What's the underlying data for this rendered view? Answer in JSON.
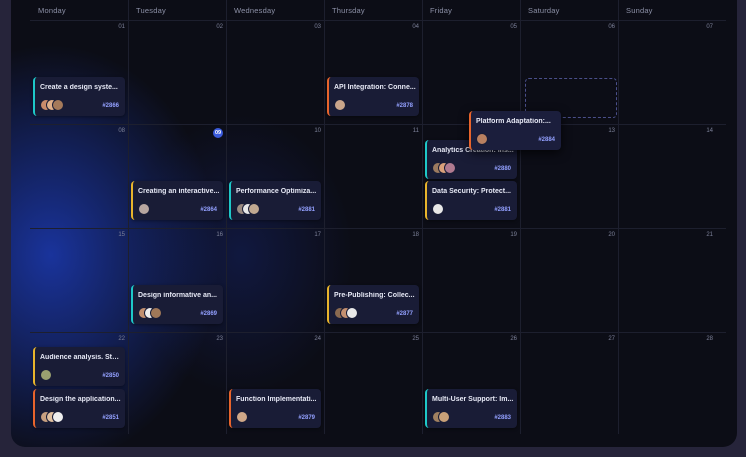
{
  "days": [
    "Monday",
    "Tuesday",
    "Wednesday",
    "Thursday",
    "Friday",
    "Saturday",
    "Sunday"
  ],
  "dates": [
    [
      "01",
      "02",
      "03",
      "04",
      "05",
      "06",
      "07"
    ],
    [
      "08",
      "09",
      "10",
      "11",
      "12",
      "13",
      "14"
    ],
    [
      "15",
      "16",
      "17",
      "18",
      "19",
      "20",
      "21"
    ],
    [
      "22",
      "23",
      "24",
      "25",
      "26",
      "27",
      "28"
    ]
  ],
  "today": "09",
  "colors": {
    "teal": "#1ec8c8",
    "orange": "#e8642c",
    "yellow": "#e8b42c",
    "accent": "#3b5bdb"
  },
  "events": [
    {
      "id": "ev1",
      "title": "Create a design syste...",
      "num": "#2866",
      "accent": "teal",
      "avatars": [
        "#c98b6b",
        "#e0b08a",
        "#a57a5a"
      ]
    },
    {
      "id": "ev2",
      "title": "API Integration: Conne...",
      "num": "#2878",
      "accent": "orange",
      "avatars": [
        "#c9a58a"
      ]
    },
    {
      "id": "ev3",
      "title": "Platform Adaptation:...",
      "num": "#2884",
      "accent": "orange",
      "avatars": [
        "#b98060"
      ]
    },
    {
      "id": "ev4",
      "title": "Analytics Creation: Ins...",
      "num": "#2880",
      "accent": "teal",
      "avatars": [
        "#9c7a5f",
        "#d9a07a",
        "#b07a90"
      ]
    },
    {
      "id": "ev5",
      "title": "Creating an interactive...",
      "num": "#2864",
      "accent": "yellow",
      "avatars": [
        "#b7a6a0"
      ]
    },
    {
      "id": "ev6",
      "title": "Performance Optimiza...",
      "num": "#2881",
      "accent": "teal",
      "avatars": [
        "#9a8a80",
        "#e8e8e8",
        "#c0a890"
      ]
    },
    {
      "id": "ev7",
      "title": "Data Security: Protect...",
      "num": "#2881",
      "accent": "yellow",
      "avatars": [
        "#e8e8e8"
      ]
    },
    {
      "id": "ev8",
      "title": "Design informative an...",
      "num": "#2869",
      "accent": "teal",
      "avatars": [
        "#c29070",
        "#eeeeee",
        "#a07858"
      ]
    },
    {
      "id": "ev9",
      "title": "Pre-Publishing: Collec...",
      "num": "#2877",
      "accent": "yellow",
      "avatars": [
        "#8a6a50",
        "#c49070",
        "#e8e8e8"
      ]
    },
    {
      "id": "ev10",
      "title": "Audience analysis. Stu...",
      "num": "#2850",
      "accent": "yellow",
      "avatars": [
        "#9aa070"
      ]
    },
    {
      "id": "ev11",
      "title": "Design the application...",
      "num": "#2851",
      "accent": "orange",
      "avatars": [
        "#c8a080",
        "#e0c0a0",
        "#eeeeee"
      ]
    },
    {
      "id": "ev12",
      "title": "Function Implementati...",
      "num": "#2879",
      "accent": "orange",
      "avatars": [
        "#d0a888"
      ]
    },
    {
      "id": "ev13",
      "title": "Multi-User Support: Im...",
      "num": "#2883",
      "accent": "teal",
      "avatars": [
        "#a08060",
        "#c8a078"
      ]
    }
  ]
}
